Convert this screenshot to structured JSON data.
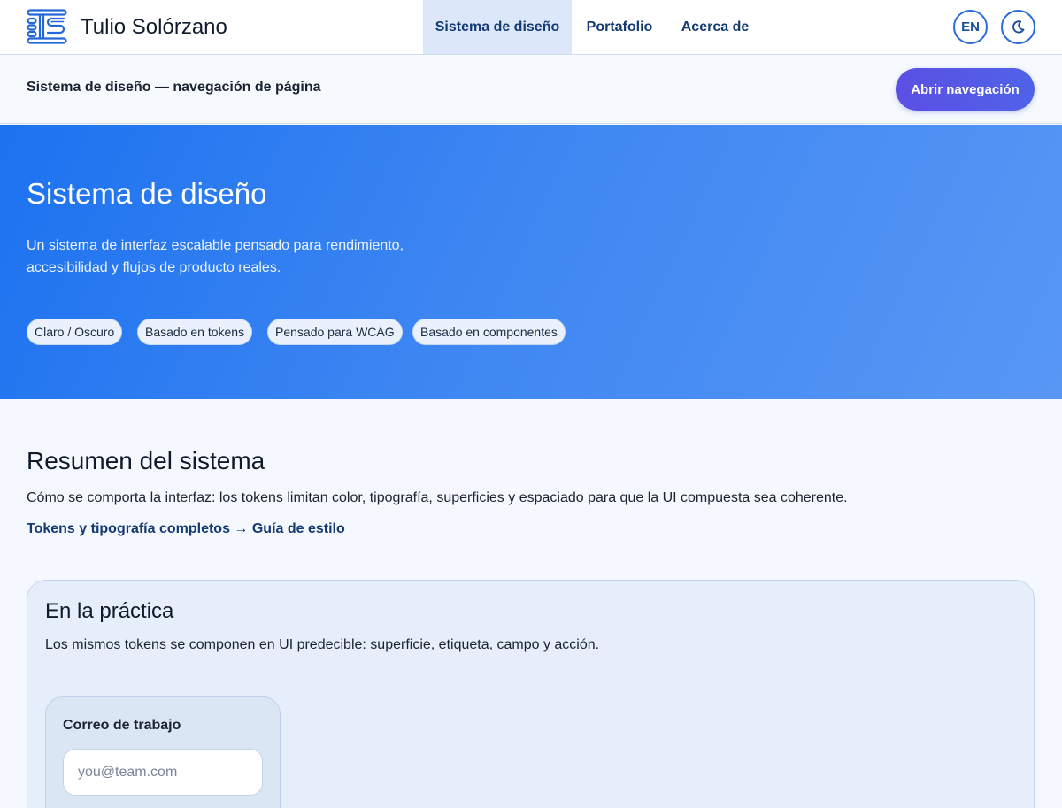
{
  "header": {
    "brand": "Tulio Solórzano",
    "nav": [
      {
        "label": "Sistema de diseño",
        "active": true
      },
      {
        "label": "Portafolio",
        "active": false
      },
      {
        "label": "Acerca de",
        "active": false
      }
    ],
    "language_button": "EN",
    "theme_icon": "moon-icon"
  },
  "subnav": {
    "title": "Sistema de diseño — navegación de página",
    "open_button": "Abrir navegación"
  },
  "hero": {
    "title": "Sistema de diseño",
    "description": "Un sistema de interfaz escalable pensado para rendimiento, accesibilidad y flujos de producto reales.",
    "chips": [
      "Claro / Oscuro",
      "Basado en tokens",
      "Pensado para WCAG",
      "Basado en componentes"
    ]
  },
  "overview": {
    "title": "Resumen del sistema",
    "description": "Cómo se comporta la interfaz: los tokens limitan color, tipografía, superficies y espaciado para que la UI compuesta sea coherente.",
    "link": "Tokens y tipografía completos → Guía de estilo"
  },
  "practice": {
    "title": "En la práctica",
    "description": "Los mismos tokens se componen en UI predecible: superficie, etiqueta, campo y acción.",
    "field": {
      "label": "Correo de trabajo",
      "placeholder": "you@team.com",
      "value": ""
    }
  },
  "colors": {
    "accent": "#1d72f0",
    "button": "#5b4fe3",
    "nav_text": "#143a72",
    "active_tab_bg": "#dce8fa"
  }
}
